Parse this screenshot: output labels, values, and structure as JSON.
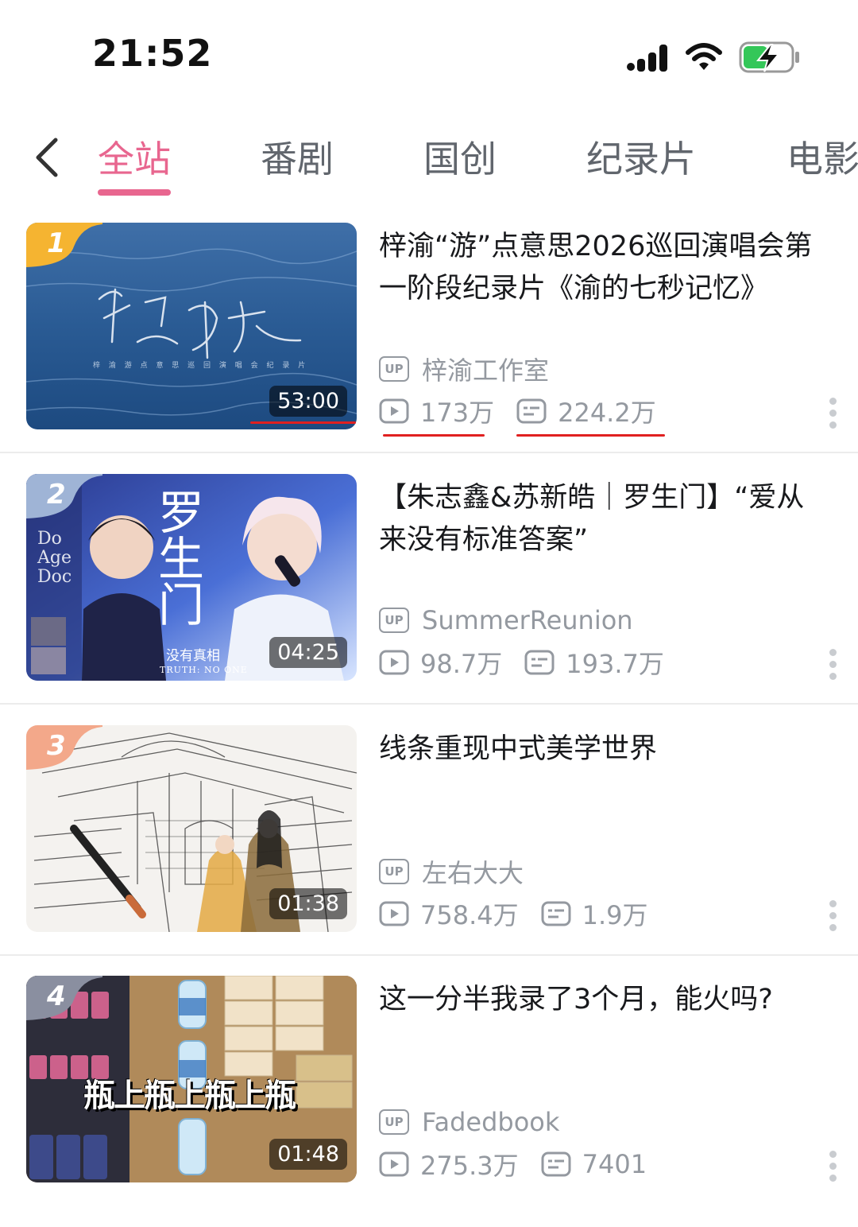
{
  "status_bar": {
    "time": "21:52"
  },
  "tabs": [
    {
      "label": "全站",
      "active": true
    },
    {
      "label": "番剧",
      "active": false
    },
    {
      "label": "国创",
      "active": false
    },
    {
      "label": "纪录片",
      "active": false
    },
    {
      "label": "电影",
      "active": false
    }
  ],
  "accent_color": "#e8668f",
  "videos": [
    {
      "rank": "1",
      "title": "梓渝“游”点意思2026巡回演唱会第一阶段纪录片《渝的七秒记忆》",
      "duration": "53:00",
      "author": "梓渝工作室",
      "views": "173万",
      "danmaku": "224.2万"
    },
    {
      "rank": "2",
      "title": "【朱志鑫&苏新皓｜罗生门】“爱从来没有标准答案”",
      "duration": "04:25",
      "author": "SummerReunion",
      "views": "98.7万",
      "danmaku": "193.7万",
      "thumb_text": {
        "main": "罗生门",
        "sub": "没有真相",
        "tag": "TRUTH: NO ONE"
      }
    },
    {
      "rank": "3",
      "title": "线条重现中式美学世界",
      "duration": "01:38",
      "author": "左右大大",
      "views": "758.4万",
      "danmaku": "1.9万"
    },
    {
      "rank": "4",
      "title": "这一分半我录了3个月，能火吗?",
      "duration": "01:48",
      "author": "Fadedbook",
      "views": "275.3万",
      "danmaku": "7401",
      "thumb_text": {
        "main": "瓶上瓶上瓶上瓶"
      }
    }
  ]
}
